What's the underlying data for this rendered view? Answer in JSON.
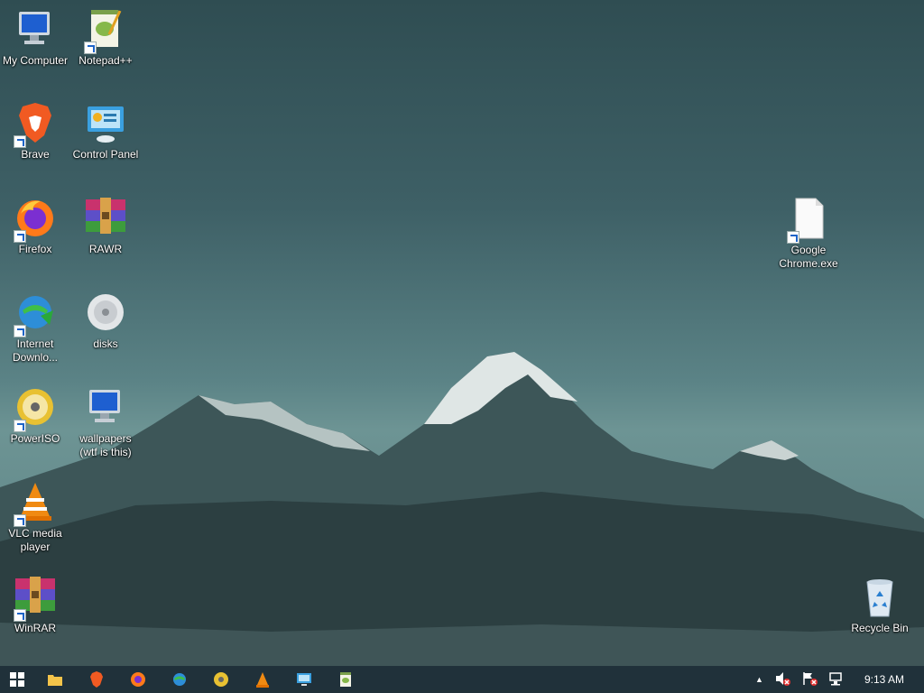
{
  "desktop": {
    "icons": [
      {
        "label": "My Computer",
        "icon": "computer-icon"
      },
      {
        "label": "Notepad++",
        "icon": "notepadpp-icon"
      },
      {
        "label": "Brave",
        "icon": "brave-icon"
      },
      {
        "label": "Control Panel",
        "icon": "control-panel-icon"
      },
      {
        "label": "Firefox",
        "icon": "firefox-icon"
      },
      {
        "label": "RAWR",
        "icon": "winrar-icon"
      },
      {
        "label": "Internet Downlo...",
        "icon": "idm-icon"
      },
      {
        "label": "disks",
        "icon": "disk-icon"
      },
      {
        "label": "PowerISO",
        "icon": "poweriso-icon"
      },
      {
        "label": "wallpapers (wtf is this)",
        "icon": "monitor-folder-icon"
      },
      {
        "label": "VLC media player",
        "icon": "vlc-icon"
      },
      {
        "label": "WinRAR",
        "icon": "winrar-icon"
      },
      {
        "label": "Google Chrome.exe",
        "icon": "blank-file-icon"
      },
      {
        "label": "Recycle Bin",
        "icon": "recycle-bin-icon"
      }
    ]
  },
  "taskbar": {
    "buttons": [
      "start-icon",
      "file-explorer-icon",
      "brave-icon",
      "firefox-icon",
      "idm-icon",
      "poweriso-icon",
      "vlc-icon",
      "control-panel-icon",
      "notepadpp-icon"
    ],
    "tray": {
      "overflow": "▲",
      "time": "9:13 AM"
    }
  },
  "colors": {
    "taskbar": "#20313a",
    "label": "#ffffff"
  }
}
